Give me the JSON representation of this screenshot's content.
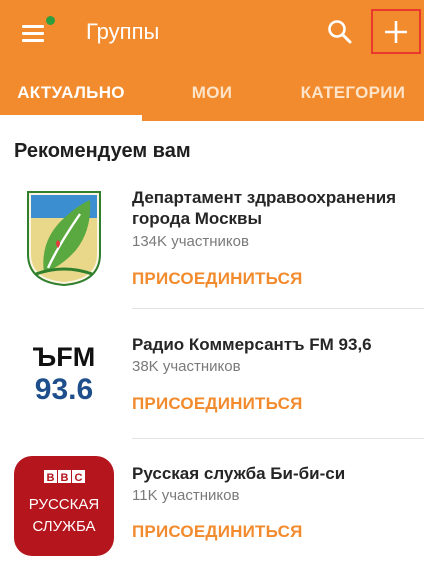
{
  "header": {
    "title": "Группы",
    "colors": {
      "brand": "#f28b2d",
      "notification_dot": "#2e9e3e",
      "highlight_box": "#e8392c"
    },
    "icons": {
      "menu": "menu-icon",
      "search": "search-icon",
      "add": "plus-icon"
    }
  },
  "tabs": [
    {
      "label": "АКТУАЛЬНО",
      "active": true
    },
    {
      "label": "МОИ",
      "active": false
    },
    {
      "label": "КАТЕГОРИИ",
      "active": false
    }
  ],
  "section": {
    "title": "Рекомендуем вам"
  },
  "groups": [
    {
      "name": "Департамент здравоохранения города Москвы",
      "members": "134K участников",
      "join_label": "ПРИСОЕДИНИТЬСЯ",
      "logo": "moscow-health-department-logo"
    },
    {
      "name": "Радио Коммерсантъ FM 93,6",
      "members": "38K участников",
      "join_label": "ПРИСОЕДИНИТЬСЯ",
      "logo": "kommersant-fm-logo",
      "logo_text": {
        "line1": "ЪFM",
        "line2": "93.6"
      }
    },
    {
      "name": "Русская служба Би-би-си",
      "members": "11K участников",
      "join_label": "ПРИСОЕДИНИТЬСЯ",
      "logo": "bbc-russian-logo",
      "logo_text": {
        "bbc": [
          "B",
          "B",
          "C"
        ],
        "line1": "РУССКАЯ",
        "line2": "СЛУЖБА"
      }
    }
  ]
}
